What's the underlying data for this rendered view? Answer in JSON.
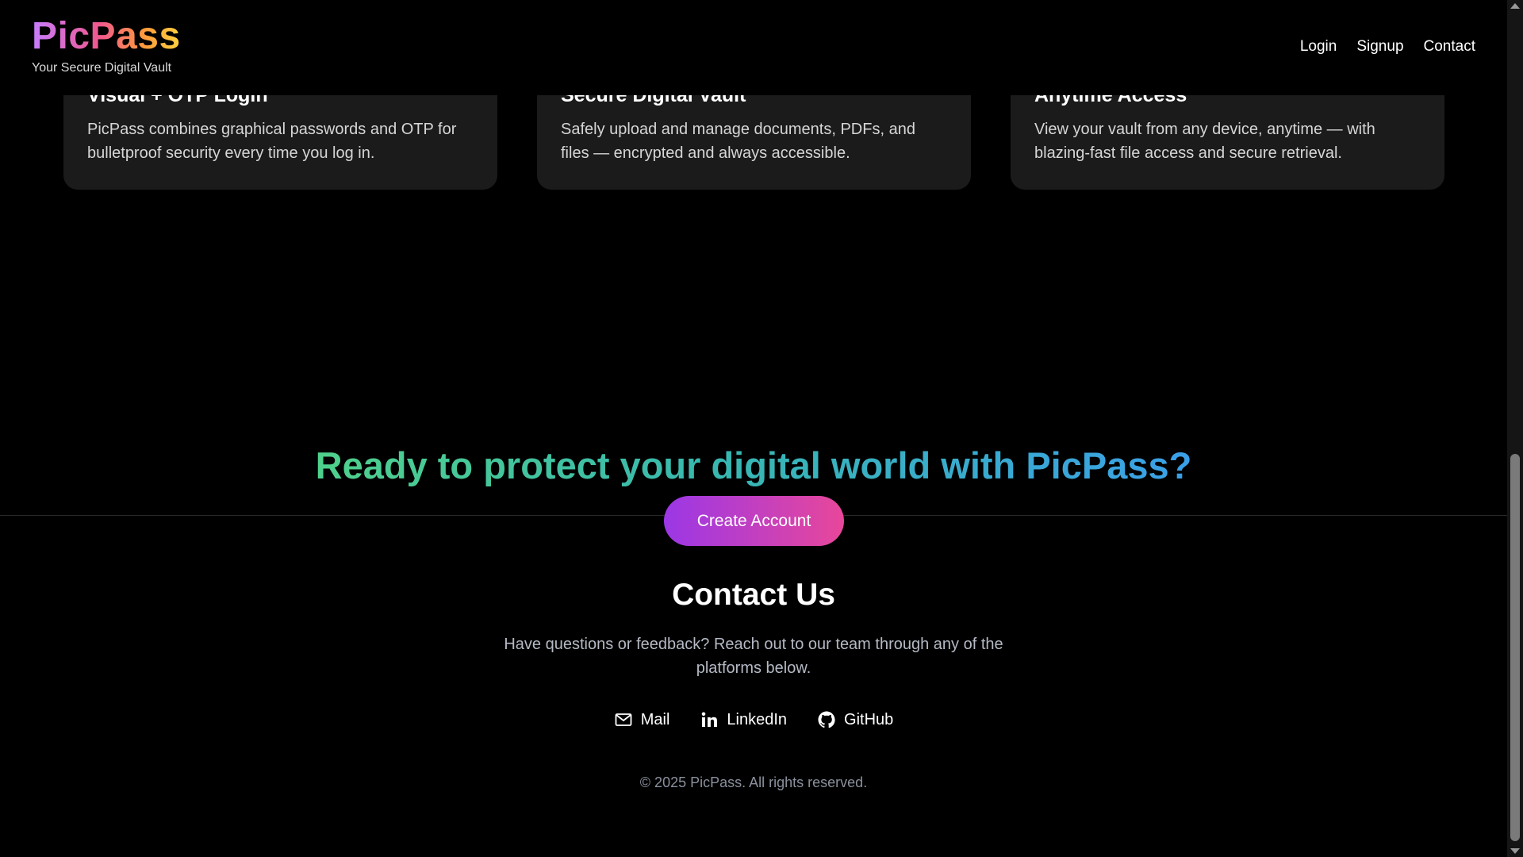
{
  "header": {
    "brand": "PicPass",
    "tagline": "Your Secure Digital Vault",
    "nav": [
      {
        "label": "Login"
      },
      {
        "label": "Signup"
      },
      {
        "label": "Contact"
      }
    ]
  },
  "features": [
    {
      "title": "Visual + OTP Login",
      "description": "PicPass combines graphical passwords and OTP for bulletproof security every time you log in."
    },
    {
      "title": "Secure Digital Vault",
      "description": "Safely upload and manage documents, PDFs, and files — encrypted and always accessible."
    },
    {
      "title": "Anytime Access",
      "description": "View your vault from any device, anytime — with blazing-fast file access and secure retrieval."
    }
  ],
  "cta": {
    "title": "Ready to protect your digital world with PicPass?",
    "button_label": "Create Account"
  },
  "contact": {
    "title": "Contact Us",
    "description": "Have questions or feedback? Reach out to our team through any of the platforms below.",
    "links": [
      {
        "label": "Mail",
        "icon": "mail-icon"
      },
      {
        "label": "LinkedIn",
        "icon": "linkedin-icon"
      },
      {
        "label": "GitHub",
        "icon": "github-icon"
      }
    ]
  },
  "footer": {
    "copyright": "© 2025 PicPass. All rights reserved."
  },
  "colors": {
    "background": "#000000",
    "card": "#1b1b1c",
    "cta_gradient_start": "#9b37e6",
    "cta_gradient_end": "#e8479a",
    "heading_gradient_start": "#4fd18b",
    "heading_gradient_end": "#3aa0e8"
  }
}
